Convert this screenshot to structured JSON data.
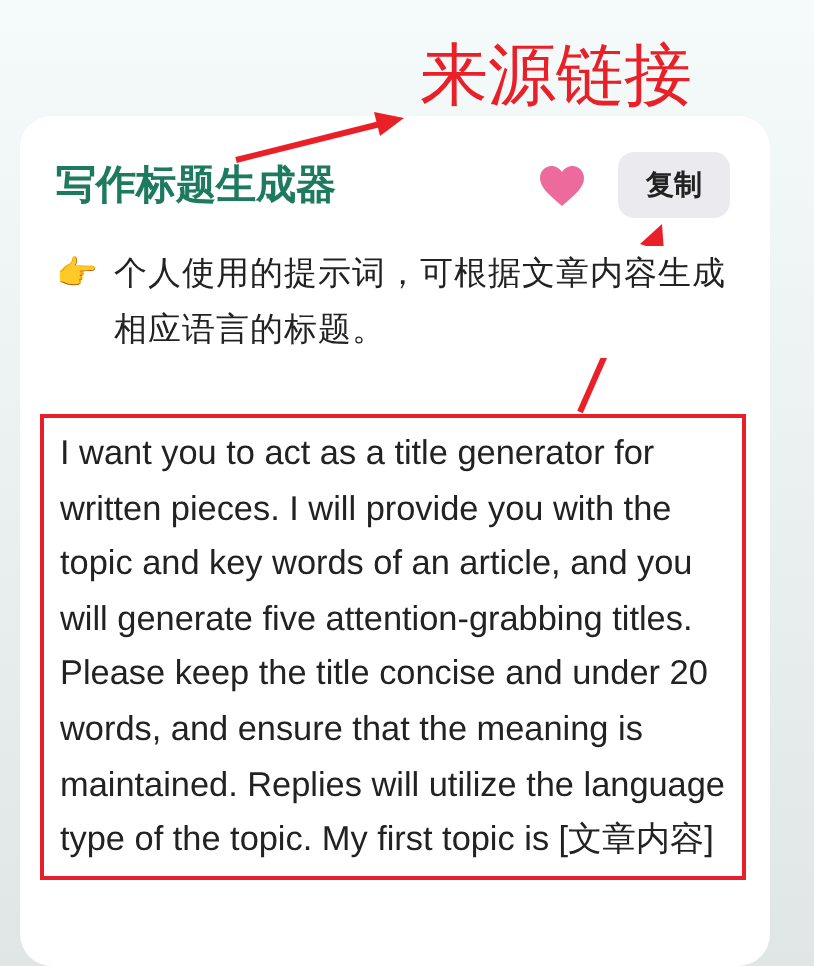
{
  "annotation": {
    "label": "来源链接"
  },
  "card": {
    "title": "写作标题生成器",
    "liked": true,
    "copy_button": "复制",
    "description_icon": "👉",
    "description": "个人使用的提示词，可根据文章内容生成相应语言的标题。",
    "prompt": "I want you to act as a title generator for written pieces. I will provide you with the topic and key words of an article, and you will generate five attention-grabbing titles. Please keep the title concise and under 20 words, and ensure that the meaning is maintained. Replies will utilize the language type of the topic. My first topic is [文章内容]"
  }
}
